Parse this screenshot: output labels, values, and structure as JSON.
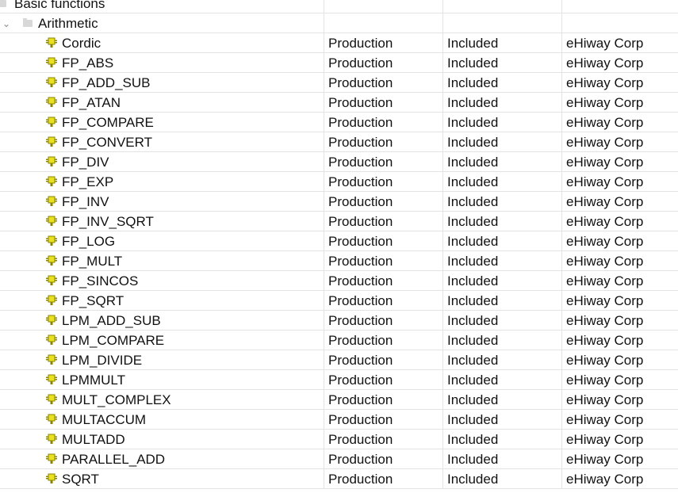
{
  "tree": {
    "category": "Basic functions",
    "group": "Arithmetic",
    "items": [
      {
        "name": "Cordic",
        "status": "Production",
        "license": "Included",
        "vendor": "eHiway Corp"
      },
      {
        "name": "FP_ABS",
        "status": "Production",
        "license": "Included",
        "vendor": "eHiway Corp"
      },
      {
        "name": "FP_ADD_SUB",
        "status": "Production",
        "license": "Included",
        "vendor": "eHiway Corp"
      },
      {
        "name": "FP_ATAN",
        "status": "Production",
        "license": "Included",
        "vendor": "eHiway Corp"
      },
      {
        "name": "FP_COMPARE",
        "status": "Production",
        "license": "Included",
        "vendor": "eHiway Corp"
      },
      {
        "name": "FP_CONVERT",
        "status": "Production",
        "license": "Included",
        "vendor": "eHiway Corp"
      },
      {
        "name": "FP_DIV",
        "status": "Production",
        "license": "Included",
        "vendor": "eHiway Corp"
      },
      {
        "name": "FP_EXP",
        "status": "Production",
        "license": "Included",
        "vendor": "eHiway Corp"
      },
      {
        "name": "FP_INV",
        "status": "Production",
        "license": "Included",
        "vendor": "eHiway Corp"
      },
      {
        "name": "FP_INV_SQRT",
        "status": "Production",
        "license": "Included",
        "vendor": "eHiway Corp"
      },
      {
        "name": "FP_LOG",
        "status": "Production",
        "license": "Included",
        "vendor": "eHiway Corp"
      },
      {
        "name": "FP_MULT",
        "status": "Production",
        "license": "Included",
        "vendor": "eHiway Corp"
      },
      {
        "name": "FP_SINCOS",
        "status": "Production",
        "license": "Included",
        "vendor": "eHiway Corp"
      },
      {
        "name": "FP_SQRT",
        "status": "Production",
        "license": "Included",
        "vendor": "eHiway Corp"
      },
      {
        "name": "LPM_ADD_SUB",
        "status": "Production",
        "license": "Included",
        "vendor": "eHiway Corp"
      },
      {
        "name": "LPM_COMPARE",
        "status": "Production",
        "license": "Included",
        "vendor": "eHiway Corp"
      },
      {
        "name": "LPM_DIVIDE",
        "status": "Production",
        "license": "Included",
        "vendor": "eHiway Corp"
      },
      {
        "name": "LPMMULT",
        "status": "Production",
        "license": "Included",
        "vendor": "eHiway Corp"
      },
      {
        "name": "MULT_COMPLEX",
        "status": "Production",
        "license": "Included",
        "vendor": "eHiway Corp"
      },
      {
        "name": "MULTACCUM",
        "status": "Production",
        "license": "Included",
        "vendor": "eHiway Corp"
      },
      {
        "name": "MULTADD",
        "status": "Production",
        "license": "Included",
        "vendor": "eHiway Corp"
      },
      {
        "name": "PARALLEL_ADD",
        "status": "Production",
        "license": "Included",
        "vendor": "eHiway Corp"
      },
      {
        "name": "SQRT",
        "status": "Production",
        "license": "Included",
        "vendor": "eHiway Corp"
      }
    ]
  },
  "colors": {
    "ip_icon": "#e8e020",
    "grid": "#e3e3e3"
  }
}
